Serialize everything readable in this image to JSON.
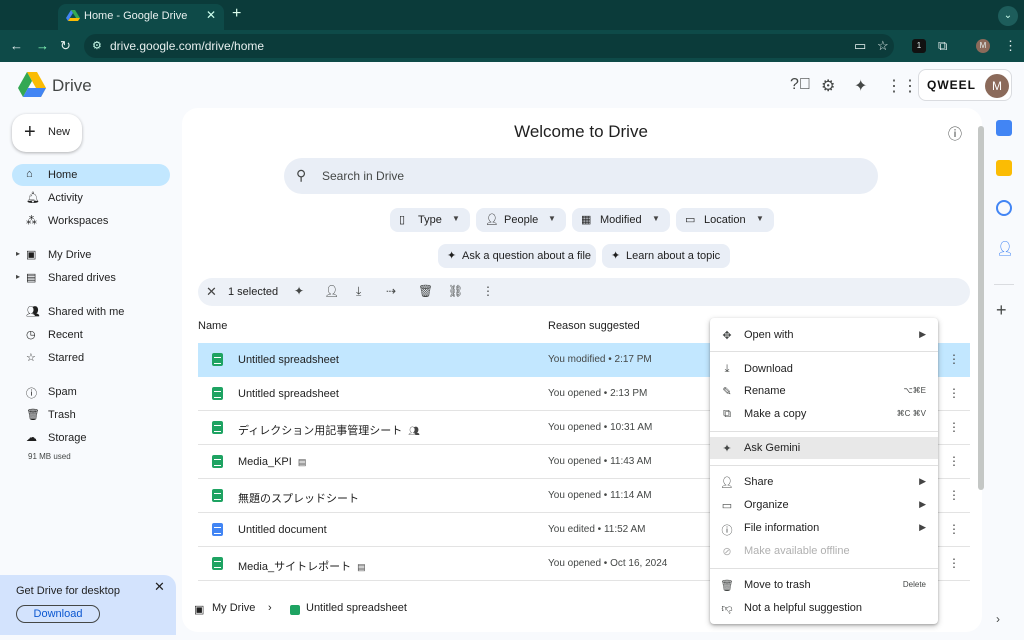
{
  "browser": {
    "tab_title": "Home - Google Drive",
    "url": "drive.google.com/drive/home",
    "profile_initial": "M"
  },
  "header": {
    "brand": "Drive",
    "account_brand": "QWEEL",
    "avatar_initial": "M"
  },
  "sidebar": {
    "new_label": "New",
    "items": [
      {
        "label": "Home",
        "icon": "home-icon",
        "active": true
      },
      {
        "label": "Activity",
        "icon": "bell-icon"
      },
      {
        "label": "Workspaces",
        "icon": "workspaces-icon"
      },
      {
        "label": "My Drive",
        "icon": "my-drive-icon"
      },
      {
        "label": "Shared drives",
        "icon": "shared-drives-icon"
      },
      {
        "label": "Shared with me",
        "icon": "people-icon"
      },
      {
        "label": "Recent",
        "icon": "clock-icon"
      },
      {
        "label": "Starred",
        "icon": "star-icon"
      },
      {
        "label": "Spam",
        "icon": "spam-icon"
      },
      {
        "label": "Trash",
        "icon": "trash-icon"
      },
      {
        "label": "Storage",
        "icon": "cloud-icon"
      }
    ],
    "storage_used": "91 MB used",
    "promo": {
      "title": "Get Drive for desktop",
      "button": "Download"
    }
  },
  "main": {
    "welcome": "Welcome to Drive",
    "search_placeholder": "Search in Drive",
    "filters": [
      "Type",
      "People",
      "Modified",
      "Location"
    ],
    "suggestions": [
      "Ask a question about a file",
      "Learn about a topic"
    ],
    "selection_count": "1 selected",
    "columns": {
      "name": "Name",
      "reason": "Reason suggested"
    },
    "files": [
      {
        "name": "Untitled spreadsheet",
        "reason": "You modified • 2:17 PM",
        "type": "sheet",
        "selected": true
      },
      {
        "name": "Untitled spreadsheet",
        "reason": "You opened • 2:13 PM",
        "type": "sheet"
      },
      {
        "name": "ディレクション用記事管理シート",
        "reason": "You opened • 10:31 AM",
        "type": "sheet",
        "badge": "shared"
      },
      {
        "name": "Media_KPI",
        "reason": "You opened • 11:43 AM",
        "type": "sheet",
        "badge": "site"
      },
      {
        "name": "無題のスプレッドシート",
        "reason": "You opened • 11:14 AM",
        "type": "sheet"
      },
      {
        "name": "Untitled document",
        "reason": "You edited • 11:52 AM",
        "type": "doc"
      },
      {
        "name": "Media_サイトレポート",
        "reason": "You opened • Oct 16, 2024",
        "type": "sheet",
        "badge": "site"
      }
    ],
    "breadcrumb": {
      "root": "My Drive",
      "file": "Untitled spreadsheet"
    }
  },
  "context_menu": {
    "items": [
      {
        "label": "Open with",
        "icon": "open-with-icon",
        "submenu": true
      },
      {
        "label": "Download",
        "icon": "download-icon"
      },
      {
        "label": "Rename",
        "icon": "pencil-icon",
        "shortcut": "⌥⌘E"
      },
      {
        "label": "Make a copy",
        "icon": "copy-icon",
        "shortcut": "⌘C ⌘V"
      },
      {
        "label": "Ask Gemini",
        "icon": "gemini-icon",
        "highlighted": true
      },
      {
        "label": "Share",
        "icon": "share-icon",
        "submenu": true
      },
      {
        "label": "Organize",
        "icon": "folder-icon",
        "submenu": true
      },
      {
        "label": "File information",
        "icon": "info-icon",
        "submenu": true
      },
      {
        "label": "Make available offline",
        "icon": "offline-icon",
        "disabled": true
      },
      {
        "label": "Move to trash",
        "icon": "trash-icon",
        "shortcut": "Delete"
      },
      {
        "label": "Not a helpful suggestion",
        "icon": "thumb-down-icon"
      }
    ]
  },
  "colors": {
    "browser_dark": "#0b3b3a",
    "selection_blue": "#c2e7ff",
    "sheets_green": "#1ea362",
    "docs_blue": "#4285f4"
  }
}
